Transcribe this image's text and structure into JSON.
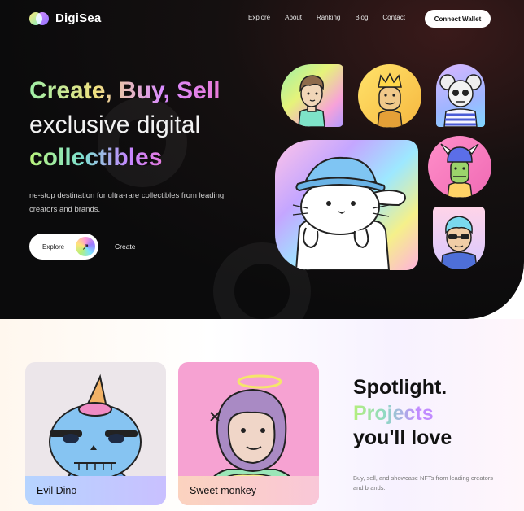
{
  "nav": {
    "logo": "DigiSea",
    "links": [
      "Explore",
      "About",
      "Ranking",
      "Blog",
      "Contact"
    ],
    "connect_button": "Connect Wallet"
  },
  "hero": {
    "headline_line1": "Create, Buy, Sell",
    "headline_line2": "exclusive digital",
    "headline_line3": "collectibles",
    "subtitle": "ne-stop destination for ultra-rare collectibles from leading creators and brands.",
    "explore_button": "Explore",
    "create_link": "Create"
  },
  "cards": [
    {
      "name": "Evil Dino"
    },
    {
      "name": "Sweet monkey"
    }
  ],
  "spotlight": {
    "line1": "Spotlight.",
    "line2": "Projects",
    "line3": "you'll love",
    "description": "Buy, sell, and showcase NFTs from leading creators and brands."
  },
  "icons": {
    "explore_arrow": "arrow-up-right-icon",
    "logo_mark": "overlapping-circles-icon"
  },
  "colors": {
    "hero_bg": "#0b0b0c",
    "accent_green": "#b4ef7c",
    "accent_purple": "#c18bff",
    "accent_pink": "#e87ad8"
  }
}
